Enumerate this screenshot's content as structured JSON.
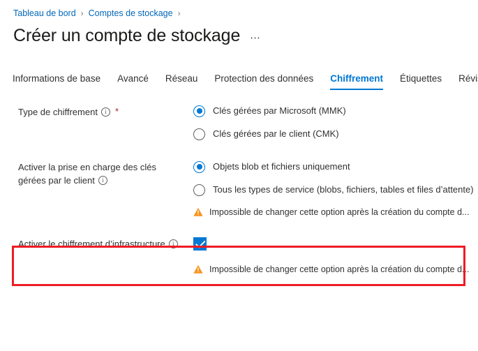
{
  "breadcrumb": {
    "items": [
      {
        "label": "Tableau de bord"
      },
      {
        "label": "Comptes de stockage"
      }
    ],
    "separator": "›"
  },
  "header": {
    "title": "Créer un compte de stockage",
    "more_menu": "⋯"
  },
  "tabs": [
    {
      "label": "Informations de base",
      "active": false
    },
    {
      "label": "Avancé",
      "active": false
    },
    {
      "label": "Réseau",
      "active": false
    },
    {
      "label": "Protection des données",
      "active": false
    },
    {
      "label": "Chiffrement",
      "active": true
    },
    {
      "label": "Étiquettes",
      "active": false
    },
    {
      "label": "Révision",
      "active": false
    }
  ],
  "form": {
    "encryption_type": {
      "label": "Type de chiffrement",
      "required_marker": "*",
      "info_tooltip": "i",
      "options": [
        {
          "label": "Clés gérées par Microsoft (MMK)",
          "selected": true
        },
        {
          "label": "Clés gérées par le client (CMK)",
          "selected": false
        }
      ]
    },
    "cmk_support": {
      "label_line1": "Activer la prise en charge des clés",
      "label_line2": "gérées par le client",
      "info_tooltip": "i",
      "options": [
        {
          "label": "Objets blob et fichiers uniquement",
          "selected": true
        },
        {
          "label": "Tous les types de service (blobs, fichiers, tables et files d’attente)",
          "selected": false
        }
      ],
      "warning": "Impossible de changer cette option après la création du compte d..."
    },
    "infrastructure_encryption": {
      "label": "Activer le chiffrement d’infrastructure",
      "info_tooltip": "i",
      "checkbox_checked": true,
      "warning": "Impossible de changer cette option après la création du compte d...",
      "highlighted": true
    }
  },
  "colors": {
    "link": "#0067b8",
    "accent": "#0078d4",
    "required": "#a4262c",
    "warning": "#f7941d",
    "highlight": "#ee1c25",
    "text": "#323130"
  }
}
